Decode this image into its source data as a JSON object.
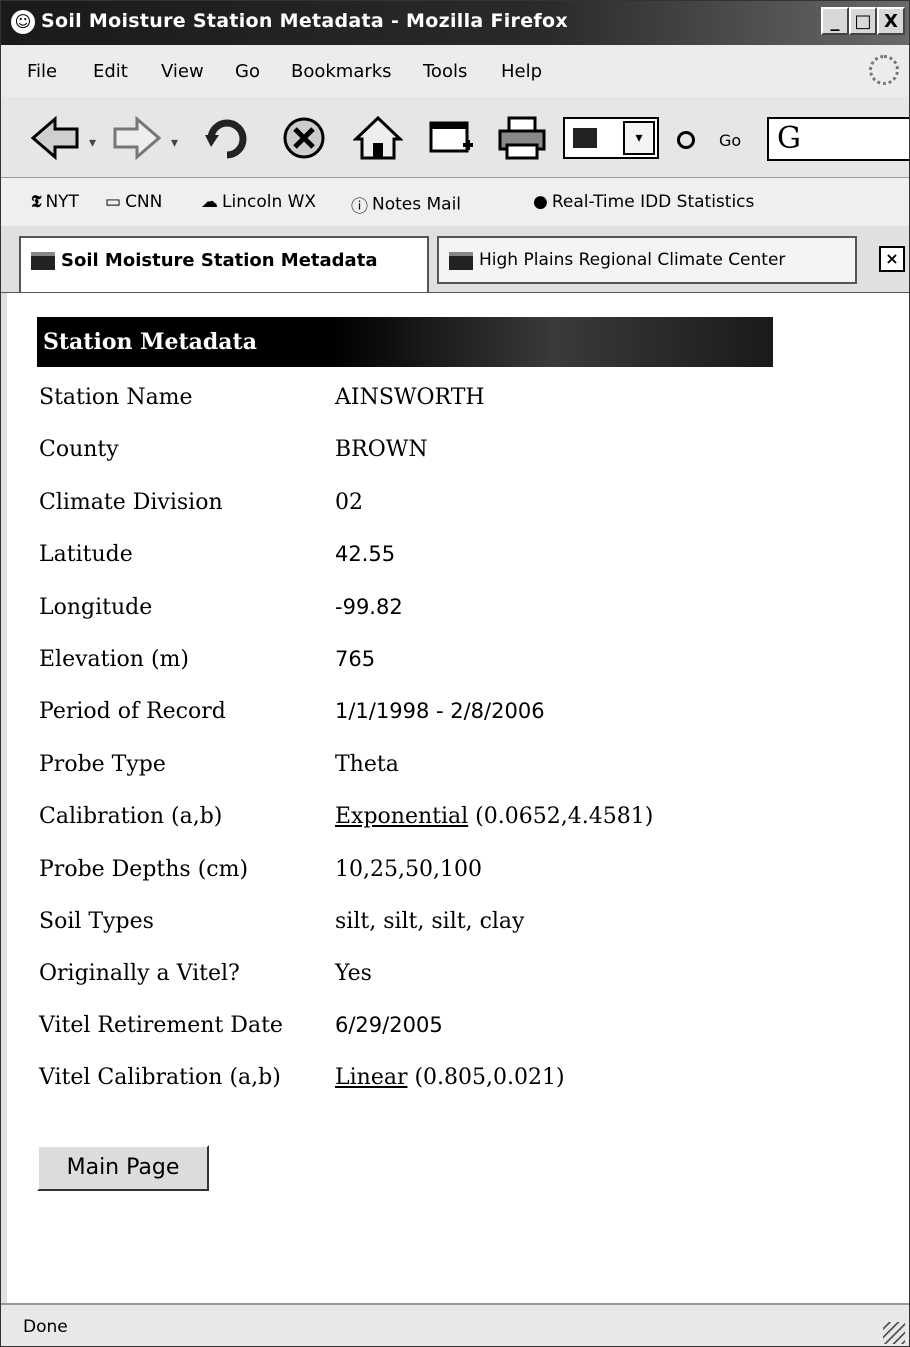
{
  "window": {
    "title": "Soil Moisture Station Metadata - Mozilla Firefox",
    "controls": {
      "minimize": "_",
      "maximize": "□",
      "close": "X"
    }
  },
  "menu": [
    "File",
    "Edit",
    "View",
    "Go",
    "Bookmarks",
    "Tools",
    "Help"
  ],
  "toolbar": {
    "go_label": "Go",
    "search_glyph": "G"
  },
  "bookmarks": [
    {
      "label": "NYT",
      "icon": "nyt-icon"
    },
    {
      "label": "CNN",
      "icon": "page-icon"
    },
    {
      "label": "Lincoln WX",
      "icon": "cloud-icon"
    },
    {
      "label": "Notes Mail",
      "icon": "notes-icon"
    },
    {
      "label": "Real-Time IDD Statistics",
      "icon": "globe-icon"
    }
  ],
  "tabs": [
    {
      "label": "Soil Moisture Station Metadata",
      "active": true
    },
    {
      "label": "High Plains Regional Climate Center",
      "active": false
    }
  ],
  "page": {
    "header": "Station Metadata",
    "rows": [
      {
        "label": "Station Name",
        "value": "AINSWORTH"
      },
      {
        "label": "County",
        "value": "BROWN"
      },
      {
        "label": "Climate Division",
        "value": "02"
      },
      {
        "label": "Latitude",
        "value": "42.55"
      },
      {
        "label": "Longitude",
        "value": "-99.82"
      },
      {
        "label": "Elevation (m)",
        "value": "765"
      },
      {
        "label": "Period of Record",
        "value": "1/1/1998 - 2/8/2006"
      },
      {
        "label": "Probe Type",
        "value": "Theta"
      },
      {
        "label": "Calibration (a,b)",
        "link": "Exponential",
        "value": " (0.0652,4.4581)"
      },
      {
        "label": "Probe Depths (cm)",
        "value": "10,25,50,100"
      },
      {
        "label": "Soil Types",
        "value": "silt, silt, silt, clay"
      },
      {
        "label": "Originally a Vitel?",
        "value": "Yes"
      },
      {
        "label": "Vitel Retirement Date",
        "value": "6/29/2005"
      },
      {
        "label": "Vitel Calibration (a,b)",
        "link": "Linear",
        "value": " (0.805,0.021)"
      }
    ],
    "main_button": "Main Page"
  },
  "status": "Done"
}
